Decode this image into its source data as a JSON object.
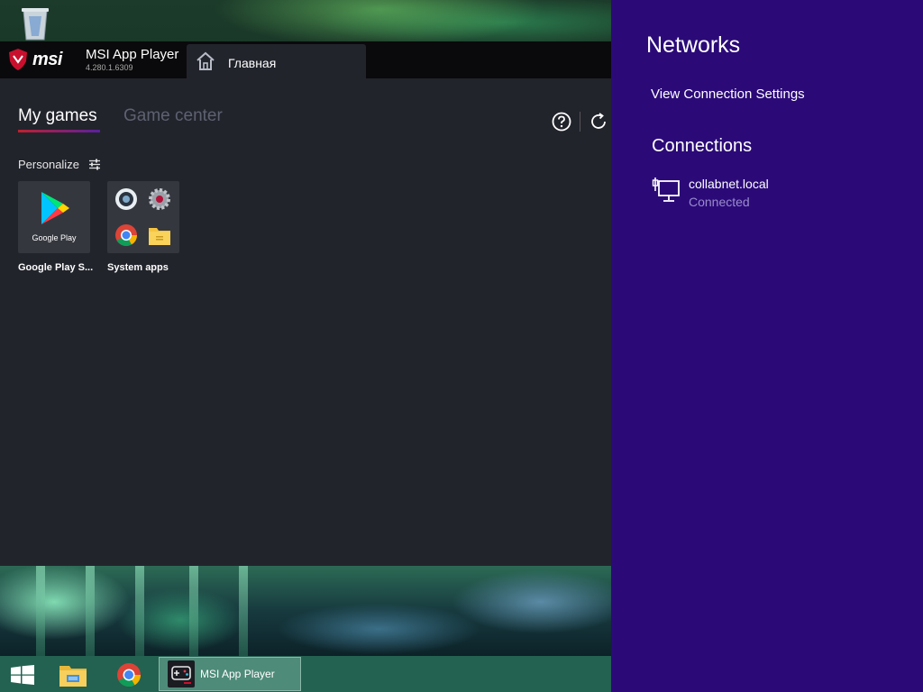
{
  "msi": {
    "logo_text": "msi",
    "app_name": "MSI App Player",
    "version": "4.280.1.6309",
    "home_tab_label": "Главная",
    "tabs": [
      {
        "label": "My games",
        "active": true
      },
      {
        "label": "Game center",
        "active": false
      }
    ],
    "personalize_label": "Personalize",
    "apps": [
      {
        "label": "Google Play S...",
        "caption": "Google Play"
      },
      {
        "label": "System apps"
      }
    ],
    "accent": "#c02030"
  },
  "taskbar": {
    "items": [
      {
        "icon": "windows-start-icon"
      },
      {
        "icon": "file-explorer-icon"
      },
      {
        "icon": "chrome-icon"
      },
      {
        "icon": "msi-app-player-icon",
        "label": "MSI App Player"
      }
    ]
  },
  "networks": {
    "title": "Networks",
    "settings_link": "View Connection Settings",
    "connections_heading": "Connections",
    "connections": [
      {
        "name": "collabnet.local",
        "status": "Connected",
        "icon": "wired-network-icon"
      }
    ],
    "background": "#2b0a78"
  }
}
